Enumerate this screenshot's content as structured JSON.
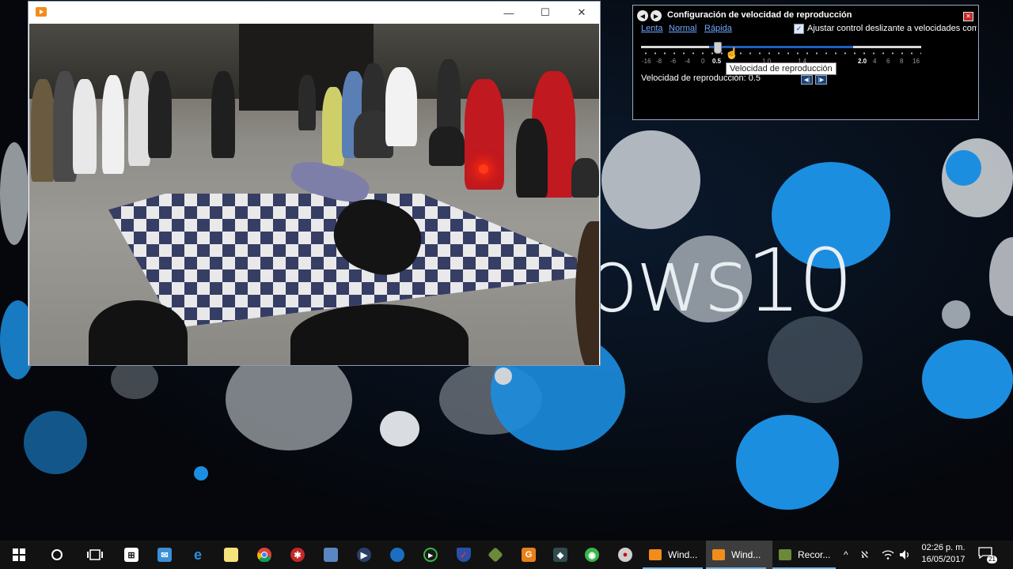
{
  "desktop": {
    "wallpaper_text": "ows10"
  },
  "player": {
    "minimize_glyph": "—",
    "maximize_glyph": "☐",
    "close_glyph": "✕",
    "app_icon": "media-player-icon"
  },
  "speed_dialog": {
    "title": "Configuración de velocidad de reproducción",
    "back_icon": "back-arrow-icon",
    "forward_icon": "forward-arrow-icon",
    "close_glyph": "✕",
    "preset_links": [
      "Lenta",
      "Normal",
      "Rápida"
    ],
    "adjust_checkbox_checked": true,
    "adjust_checkbox_label": "Ajustar control deslizante a velocidades com",
    "slider_ticks": [
      "-16",
      "-8",
      "-6",
      "-4",
      "0",
      "0.5",
      "1.0",
      "1.4",
      "2.0",
      "4",
      "6",
      "8",
      "16"
    ],
    "slider_value": 0.5,
    "tooltip": "Velocidad de reproducción",
    "readout": "Velocidad de reproducción: 0.5"
  },
  "taskbar": {
    "pinned_icons": [
      "start-icon",
      "cortana-icon",
      "task-view-icon",
      "store-icon",
      "mail-icon",
      "edge-icon",
      "notes-icon",
      "chrome-icon",
      "app-red-icon",
      "photos-icon",
      "media-player-pinned-icon",
      "globe-icon",
      "camtasia-icon",
      "shield-app-icon",
      "app-green-icon",
      "office-icon",
      "app-dark-icon",
      "app-green2-icon",
      "paint-icon"
    ],
    "running_tasks": [
      {
        "label": "Wind...",
        "active": false
      },
      {
        "label": "Wind...",
        "active": true
      },
      {
        "label": "Recor...",
        "active": false
      }
    ],
    "tray_icons": [
      "chevron-up-icon",
      "language-icon",
      "wifi-icon",
      "volume-icon"
    ],
    "time": "02:26 p. m.",
    "date": "16/05/2017",
    "notification_count": "21"
  }
}
